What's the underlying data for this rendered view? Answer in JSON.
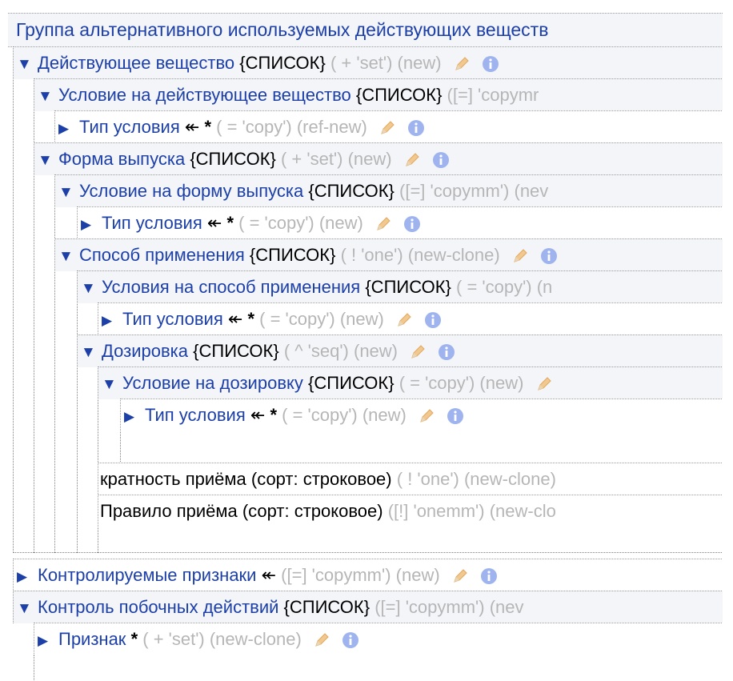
{
  "header": {
    "title": "Группа альтернативного используемых действующих веществ"
  },
  "labels": {
    "list": "{СПИСОК}"
  },
  "icons": {
    "edit": "pencil-icon",
    "info": "info-icon"
  },
  "colors": {
    "link": "#1c3fa8",
    "meta": "#b6b6b6",
    "row_bg": "#f3f5f9",
    "icon_orange": "#f0c890",
    "icon_blue": "#9fb4ee"
  },
  "tree": [
    {
      "expanded": true,
      "name": "Действующее вещество",
      "tag": "{СПИСОК}",
      "meta": "( + 'set') (new)"
    },
    {
      "expanded": true,
      "name": "Условие на действующее вещество",
      "tag": "{СПИСОК}",
      "meta": "([=] 'copymr"
    },
    {
      "expanded": false,
      "name": "Тип условия",
      "ref": "↞",
      "star": "*",
      "meta": "( = 'copy') (ref-new)"
    },
    {
      "expanded": true,
      "name": "Форма выпуска",
      "tag": "{СПИСОК}",
      "meta": "( + 'set') (new)"
    },
    {
      "expanded": true,
      "name": "Условие на форму выпуска",
      "tag": "{СПИСОК}",
      "meta": "([=] 'copymm') (nev"
    },
    {
      "expanded": false,
      "name": "Тип условия",
      "ref": "↞",
      "star": "*",
      "meta": "( = 'copy') (new)"
    },
    {
      "expanded": true,
      "name": "Способ применения",
      "tag": "{СПИСОК}",
      "meta": "( ! 'one') (new-clone)"
    },
    {
      "expanded": true,
      "name": "Условия на способ применения",
      "tag": "{СПИСОК}",
      "meta": "( = 'copy') (n"
    },
    {
      "expanded": false,
      "name": "Тип условия",
      "ref": "↞",
      "star": "*",
      "meta": "( = 'copy') (new)"
    },
    {
      "expanded": true,
      "name": "Дозировка",
      "tag": "{СПИСОК}",
      "meta": "( ^ 'seq') (new)"
    },
    {
      "expanded": true,
      "name": "Условие на дозировку",
      "tag": "{СПИСОК}",
      "meta": "( = 'copy') (new)"
    },
    {
      "expanded": false,
      "name": "Тип условия",
      "ref": "↞",
      "star": "*",
      "meta": "( = 'copy') (new)"
    },
    {
      "attr": "кратность приёма (сорт: строковое)",
      "meta": "( ! 'one') (new-clone)"
    },
    {
      "attr": "Правило приёма (сорт: строковое)",
      "meta": "([!] 'onemm') (new-clo"
    },
    {
      "expanded": false,
      "name": "Контролируемые признаки",
      "ref": "↞",
      "meta": "([=] 'copymm') (new)"
    },
    {
      "expanded": true,
      "name": "Контроль побочных действий",
      "tag": "{СПИСОК}",
      "meta": "([=] 'copymm') (nev"
    },
    {
      "expanded": false,
      "name": "Признак",
      "star": "*",
      "meta": "( + 'set') (new-clone)"
    }
  ]
}
